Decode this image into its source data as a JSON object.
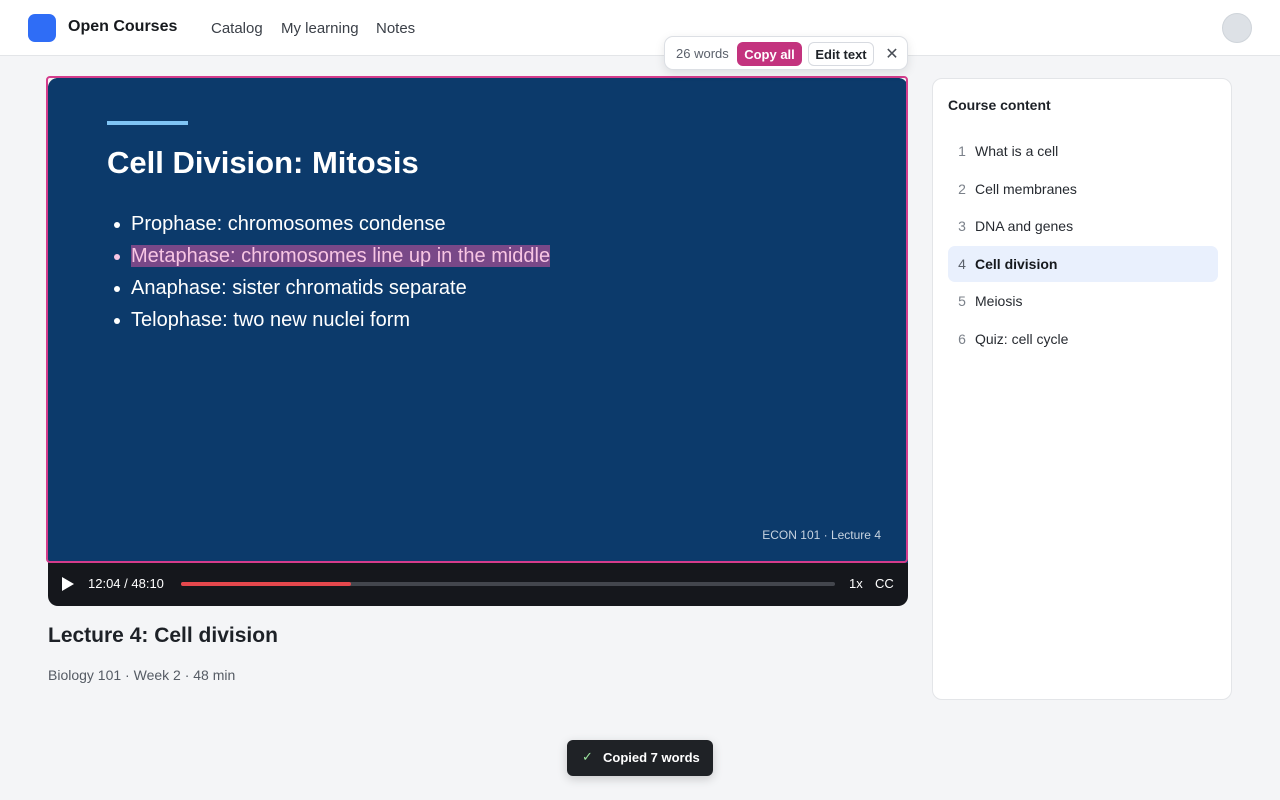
{
  "app": {
    "brand": "Open Courses"
  },
  "nav": {
    "items": [
      "Catalog",
      "My learning",
      "Notes"
    ]
  },
  "ocr_toolbar": {
    "word_count": "26 words",
    "copy_all_label": "Copy all",
    "edit_text_label": "Edit text",
    "close_glyph": "✕"
  },
  "slide": {
    "title": "Cell Division: Mitosis",
    "bullets": [
      "Prophase: chromosomes condense",
      "Metaphase: chromosomes line up in the middle",
      "Anaphase: sister chromatids separate",
      "Telophase: two new nuclei form"
    ],
    "selected_bullet_index": 1,
    "footer": "ECON 101 · Lecture 4"
  },
  "player": {
    "time": "12:04 / 48:10",
    "progress_fraction": 0.26,
    "speed": "1x",
    "captions": "CC"
  },
  "lecture": {
    "title": "Lecture 4: Cell division",
    "meta": "Biology 101 · Week 2 · 48 min"
  },
  "sidebar": {
    "title": "Course content",
    "lessons": [
      {
        "num": "1",
        "label": "What is a cell",
        "active": false
      },
      {
        "num": "2",
        "label": "Cell membranes",
        "active": false
      },
      {
        "num": "3",
        "label": "DNA and genes",
        "active": false
      },
      {
        "num": "4",
        "label": "Cell division",
        "active": true
      },
      {
        "num": "5",
        "label": "Meiosis",
        "active": false
      },
      {
        "num": "6",
        "label": "Quiz: cell cycle",
        "active": false
      }
    ]
  },
  "toast": {
    "check_glyph": "✓",
    "text": "Copied 7 words"
  },
  "colors": {
    "brand": "#2f6df6",
    "slide_background": "#0c3a6b",
    "selection_accent": "#d43c8c",
    "copy_button": "#c3337e",
    "progress": "#e5484d",
    "active_lesson_bg": "#e9f0fd"
  }
}
